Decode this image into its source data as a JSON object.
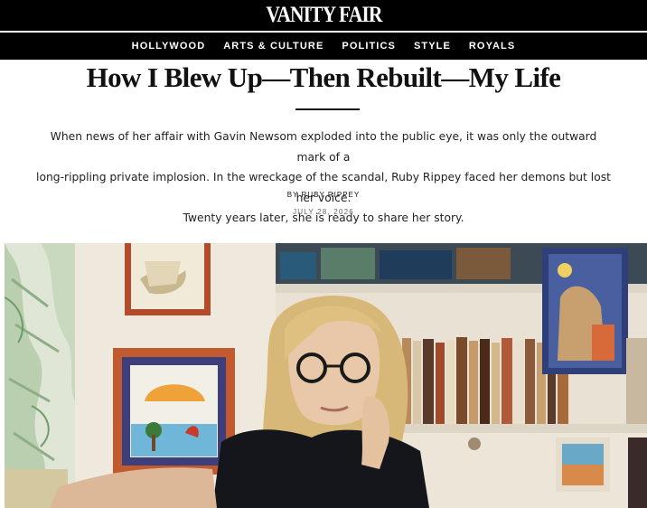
{
  "masthead": {
    "logo": "VANITY FAIR"
  },
  "nav": {
    "items": [
      "HOLLYWOOD",
      "ARTS & CULTURE",
      "POLITICS",
      "STYLE",
      "ROYALS"
    ]
  },
  "article": {
    "headline": "How I Blew Up—Then Rebuilt—My Life",
    "dek_lines": [
      "When news of her affair with Gavin Newsom exploded into the public eye, it was only the outward mark of a",
      "long-rippling private implosion. In the wreckage of the scandal, Ruby Rippey faced her demons but lost her voice.",
      "Twenty years later, she is ready to share her story."
    ],
    "byline": "BY RUBY RIPPEY",
    "date": "JULY 28, 2026"
  },
  "colors": {
    "masthead_bg": "#000000",
    "nav_text": "#ffffff",
    "date_text": "#666666"
  }
}
